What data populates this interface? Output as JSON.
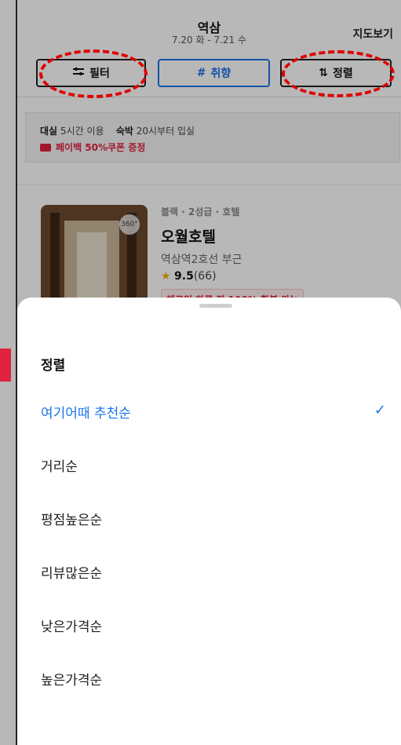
{
  "header": {
    "title": "역삼",
    "dates": "7.20 화 - 7.21 수",
    "map_view": "지도보기"
  },
  "toolbar": {
    "filter_label": "필터",
    "preference_label": "취향",
    "sort_label": "정렬",
    "filter_icon": "sliders-icon",
    "preference_icon": "hash-icon",
    "sort_icon": "sort-arrows-icon"
  },
  "notice": {
    "day_use_label": "대실",
    "day_use_text": "5시간 이용",
    "stay_label": "숙박",
    "stay_text": "20시부터 입실",
    "coupon_text": "페이백 50%쿠폰 증정"
  },
  "hotel": {
    "grade": "블랙 · 2성급 · 호텔",
    "name": "오월호텔",
    "location": "역삼역2호선 부근",
    "rating": "9.5",
    "reviews": "(66)",
    "tag": "체크인 하루 전 100% 환불 가능",
    "badge": "360°"
  },
  "sort_sheet": {
    "title": "정렬",
    "options": [
      {
        "label": "여기어때 추천순",
        "selected": true
      },
      {
        "label": "거리순",
        "selected": false
      },
      {
        "label": "평점높은순",
        "selected": false
      },
      {
        "label": "리뷰많은순",
        "selected": false
      },
      {
        "label": "낮은가격순",
        "selected": false
      },
      {
        "label": "높은가격순",
        "selected": false
      }
    ],
    "check_icon": "checkmark-icon"
  },
  "colors": {
    "accent": "#1a73e8",
    "brand_red": "#e2213f",
    "annotation_red": "#e00000"
  }
}
